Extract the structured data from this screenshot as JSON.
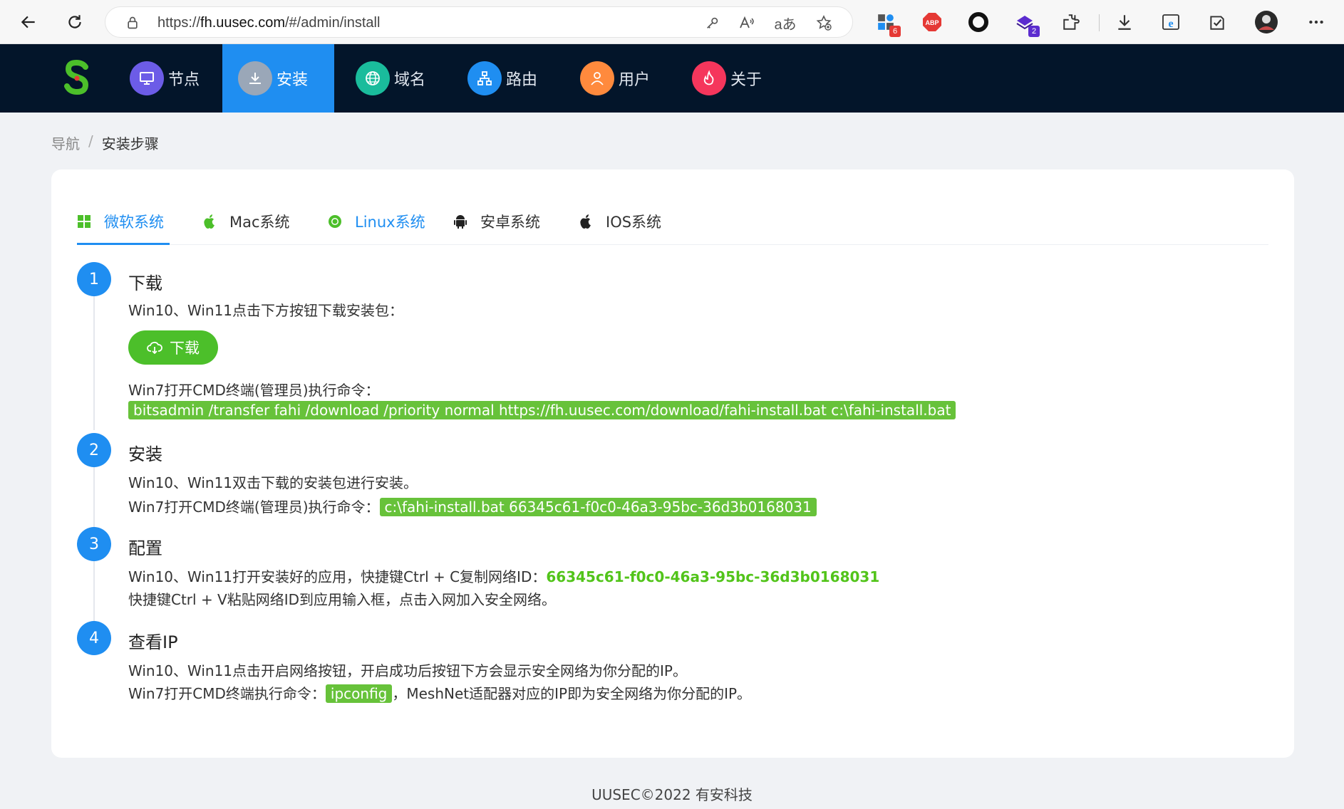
{
  "browser": {
    "url_prefix": "https://",
    "url_host": "fh.uusec.com",
    "url_path": "/#/admin/install",
    "translate_label": "aあ",
    "ext_badges": [
      "6",
      "2"
    ],
    "abp_label": "ABP"
  },
  "nav": {
    "items": [
      {
        "label": "节点",
        "color": "#6c5ce7"
      },
      {
        "label": "安装",
        "color": "#9aa7b8"
      },
      {
        "label": "域名",
        "color": "#1abc9c"
      },
      {
        "label": "路由",
        "color": "#1f8ef1"
      },
      {
        "label": "用户",
        "color": "#ff8a3d"
      },
      {
        "label": "关于",
        "color": "#f5365c"
      }
    ],
    "active_index": 1,
    "bg_color": "#03152a",
    "active_color": "#1f8ef1"
  },
  "breadcrumb": {
    "home": "导航",
    "separator": "/",
    "current": "安装步骤"
  },
  "tabs": [
    {
      "label": "微软系统",
      "icon": "windows-icon"
    },
    {
      "label": "Mac系统",
      "icon": "apple-icon"
    },
    {
      "label": "Linux系统",
      "icon": "chrome-icon"
    },
    {
      "label": "安卓系统",
      "icon": "android-icon"
    },
    {
      "label": "IOS系统",
      "icon": "apple-icon"
    }
  ],
  "steps": [
    {
      "num": "1",
      "title": "下载",
      "line1": "Win10、Win11点击下方按钮下载安装包：",
      "button": "下载",
      "line2": "Win7打开CMD终端(管理员)执行命令：",
      "code": "bitsadmin /transfer fahi /download /priority normal https://fh.uusec.com/download/fahi-install.bat c:\\fahi-install.bat"
    },
    {
      "num": "2",
      "title": "安装",
      "line1": "Win10、Win11双击下载的安装包进行安装。",
      "line2": "Win7打开CMD终端(管理员)执行命令：",
      "code": "c:\\fahi-install.bat 66345c61-f0c0-46a3-95bc-36d3b0168031"
    },
    {
      "num": "3",
      "title": "配置",
      "line1": "Win10、Win11打开安装好的应用，快捷键Ctrl + C复制网络ID：",
      "network_id": "66345c61-f0c0-46a3-95bc-36d3b0168031",
      "line2": "快捷键Ctrl + V粘贴网络ID到应用输入框，点击入网加入安全网络。"
    },
    {
      "num": "4",
      "title": "查看IP",
      "line1": "Win10、Win11点击开启网络按钮，开启成功后按钮下方会显示安全网络为你分配的IP。",
      "line2_prefix": "Win7打开CMD终端执行命令：",
      "code": "ipconfig",
      "line2_suffix": "，MeshNet适配器对应的IP即为安全网络为你分配的IP。"
    }
  ],
  "footer": "UUSEC©2022 有安科技"
}
